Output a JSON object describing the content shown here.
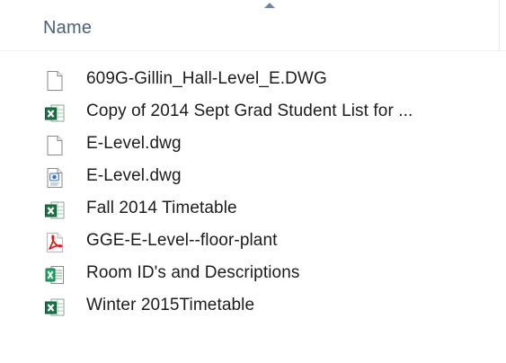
{
  "header": {
    "name_label": "Name"
  },
  "files": [
    {
      "name": "609G-Gillin_Hall-Level_E.DWG",
      "icon": "blank-file-icon"
    },
    {
      "name": "Copy of 2014 Sept Grad Student List for ...",
      "icon": "excel-icon"
    },
    {
      "name": "E-Level.dwg",
      "icon": "blank-file-icon"
    },
    {
      "name": "E-Level.dwg",
      "icon": "dwg-viewer-file-icon"
    },
    {
      "name": "Fall 2014 Timetable",
      "icon": "excel-icon"
    },
    {
      "name": "GGE-E-Level--floor-plant",
      "icon": "pdf-icon"
    },
    {
      "name": "Room ID's and Descriptions",
      "icon": "excel-legacy-icon"
    },
    {
      "name": "Winter 2015Timetable",
      "icon": "excel-icon"
    }
  ],
  "colors": {
    "header_text": "#4c607a",
    "file_text": "#1c1c1c",
    "excel_green": "#1e7145",
    "pdf_red": "#d61f26"
  }
}
